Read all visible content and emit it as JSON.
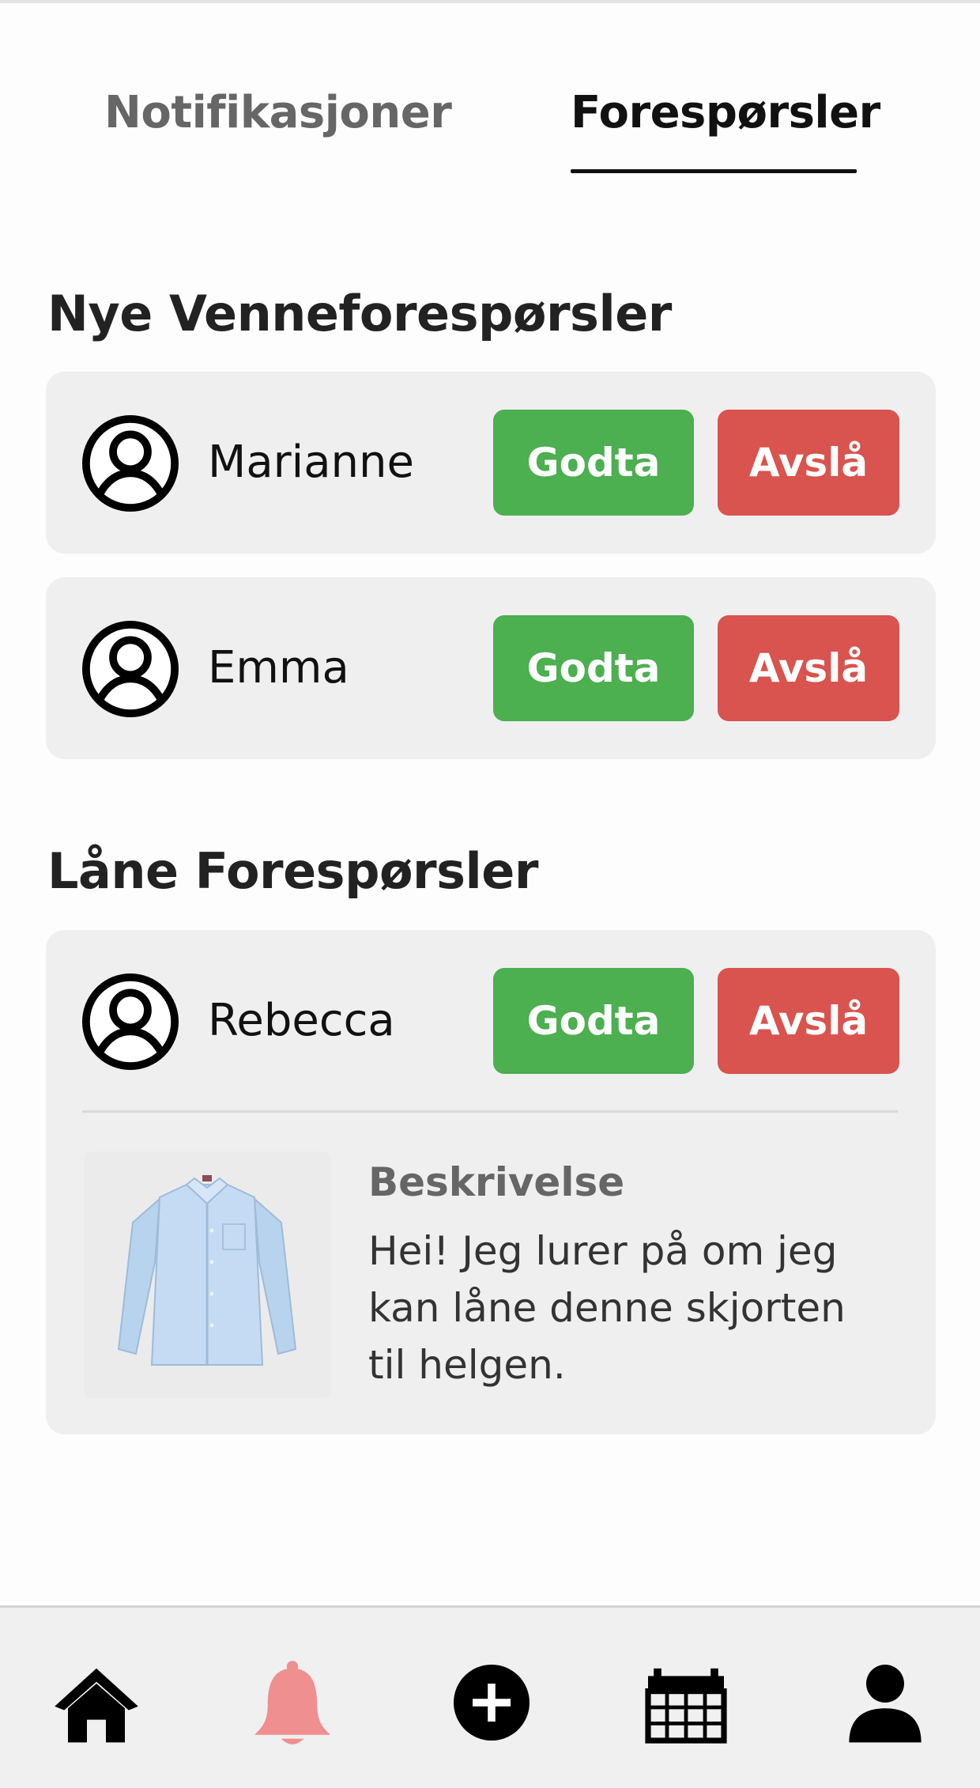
{
  "tabs": {
    "notifications": "Notifikasjoner",
    "requests": "Forespørsler",
    "active": "requests"
  },
  "friend_requests": {
    "title": "Nye Venneforespørsler",
    "items": [
      {
        "name": "Marianne",
        "accept": "Godta",
        "decline": "Avslå"
      },
      {
        "name": "Emma",
        "accept": "Godta",
        "decline": "Avslå"
      }
    ]
  },
  "loan_requests": {
    "title": "Låne Forespørsler",
    "items": [
      {
        "name": "Rebecca",
        "accept": "Godta",
        "decline": "Avslå",
        "description_title": "Beskrivelse",
        "description": "Hei! Jeg lurer på om jeg kan låne denne skjorten til helgen."
      }
    ]
  },
  "nav": {
    "items": [
      "home-icon",
      "bell-icon",
      "add-icon",
      "calendar-icon",
      "profile-icon"
    ],
    "active": "bell-icon",
    "active_color": "#ef8f8f"
  },
  "colors": {
    "accept": "#4caf50",
    "decline": "#d9534f",
    "card": "#efefef"
  }
}
